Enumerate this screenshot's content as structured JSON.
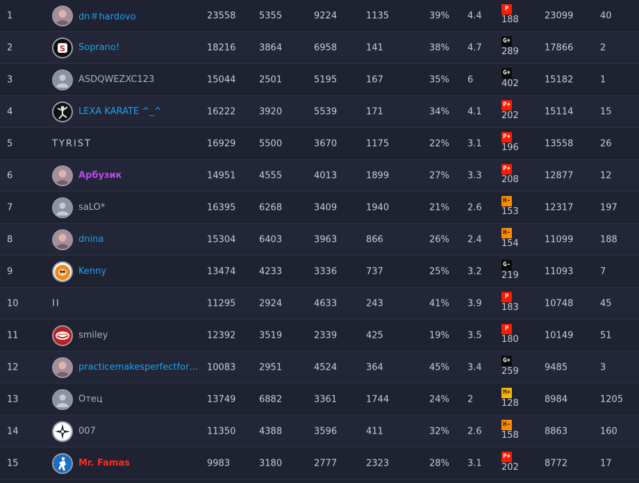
{
  "colors": {
    "P": {
      "bg": "#ff1a00",
      "fg": "#ffffff"
    },
    "P+": {
      "bg": "#ff1a00",
      "fg": "#ffffff"
    },
    "G+": {
      "bg": "#0b0b0b",
      "fg": "#ffffff"
    },
    "G-": {
      "bg": "#0b0b0b",
      "fg": "#ffffff"
    },
    "H-": {
      "bg": "#ff8a00",
      "fg": "#3a1a00"
    },
    "M+": {
      "bg": "#f0b800",
      "fg": "#3a2a00"
    }
  },
  "rows": [
    {
      "rank": "1",
      "name": "dn＃hardovo",
      "name_color": "blue",
      "avatar": "photo-avatar",
      "v1": "23558",
      "v2": "5355",
      "v3": "9224",
      "v4": "1135",
      "pct": "39%",
      "rating": "4.4",
      "badge": "P",
      "badge_num": "188",
      "v5": "23099",
      "last": "40"
    },
    {
      "rank": "2",
      "name": "Soprano!",
      "name_color": "blue",
      "avatar": "s-logo-avatar",
      "v1": "18216",
      "v2": "3864",
      "v3": "6958",
      "v4": "141",
      "pct": "38%",
      "rating": "4.7",
      "badge": "G+",
      "badge_num": "289",
      "v5": "17866",
      "last": "2"
    },
    {
      "rank": "3",
      "name": "ASDQWEZXC123",
      "name_color": "gray",
      "avatar": "default-avatar",
      "v1": "15044",
      "v2": "2501",
      "v3": "5195",
      "v4": "167",
      "pct": "35%",
      "rating": "6",
      "badge": "G+",
      "badge_num": "402",
      "v5": "15182",
      "last": "1"
    },
    {
      "rank": "4",
      "name": "LEXA KARATE ^_^",
      "name_color": "blue",
      "avatar": "karate-avatar",
      "v1": "16222",
      "v2": "3920",
      "v3": "5539",
      "v4": "171",
      "pct": "34%",
      "rating": "4.1",
      "badge": "P+",
      "badge_num": "202",
      "v5": "15114",
      "last": "15"
    },
    {
      "rank": "5",
      "name": "TYRIST",
      "name_color": "spaced",
      "avatar": "",
      "v1": "16929",
      "v2": "5500",
      "v3": "3670",
      "v4": "1175",
      "pct": "22%",
      "rating": "3.1",
      "badge": "P+",
      "badge_num": "196",
      "v5": "13558",
      "last": "26"
    },
    {
      "rank": "6",
      "name": "Арбузик",
      "name_color": "purple",
      "avatar": "photo-avatar",
      "v1": "14951",
      "v2": "4555",
      "v3": "4013",
      "v4": "1899",
      "pct": "27%",
      "rating": "3.3",
      "badge": "P+",
      "badge_num": "208",
      "v5": "12877",
      "last": "12"
    },
    {
      "rank": "7",
      "name": "saLO*",
      "name_color": "gray",
      "avatar": "default-avatar",
      "v1": "16395",
      "v2": "6268",
      "v3": "3409",
      "v4": "1940",
      "pct": "21%",
      "rating": "2.6",
      "badge": "H-",
      "badge_num": "153",
      "v5": "12317",
      "last": "197"
    },
    {
      "rank": "8",
      "name": "dnina",
      "name_color": "blue",
      "avatar": "photo-avatar",
      "v1": "15304",
      "v2": "6403",
      "v3": "3963",
      "v4": "866",
      "pct": "26%",
      "rating": "2.4",
      "badge": "H-",
      "badge_num": "154",
      "v5": "11099",
      "last": "188"
    },
    {
      "rank": "9",
      "name": "Kenny",
      "name_color": "blue",
      "avatar": "kenny-avatar",
      "v1": "13474",
      "v2": "4233",
      "v3": "3336",
      "v4": "737",
      "pct": "25%",
      "rating": "3.2",
      "badge": "G-",
      "badge_num": "219",
      "v5": "11093",
      "last": "7"
    },
    {
      "rank": "10",
      "name": "II",
      "name_color": "spaced",
      "avatar": "",
      "v1": "11295",
      "v2": "2924",
      "v3": "4633",
      "v4": "243",
      "pct": "41%",
      "rating": "3.9",
      "badge": "P",
      "badge_num": "183",
      "v5": "10748",
      "last": "45"
    },
    {
      "rank": "11",
      "name": "smiley",
      "name_color": "gray",
      "avatar": "smiley-avatar",
      "v1": "12392",
      "v2": "3519",
      "v3": "2339",
      "v4": "425",
      "pct": "19%",
      "rating": "3.5",
      "badge": "P",
      "badge_num": "180",
      "v5": "10149",
      "last": "51"
    },
    {
      "rank": "12",
      "name": "practicemakesperfectfor…",
      "name_color": "blue",
      "avatar": "photo-avatar",
      "v1": "10083",
      "v2": "2951",
      "v3": "4524",
      "v4": "364",
      "pct": "45%",
      "rating": "3.4",
      "badge": "G+",
      "badge_num": "259",
      "v5": "9485",
      "last": "3"
    },
    {
      "rank": "13",
      "name": "Отец",
      "name_color": "gray",
      "avatar": "default-avatar",
      "v1": "13749",
      "v2": "6882",
      "v3": "3361",
      "v4": "1744",
      "pct": "24%",
      "rating": "2",
      "badge": "M+",
      "badge_num": "128",
      "v5": "8984",
      "last": "1205"
    },
    {
      "rank": "14",
      "name": "007",
      "name_color": "gray",
      "avatar": "compass-avatar",
      "v1": "11350",
      "v2": "4388",
      "v3": "3596",
      "v4": "411",
      "pct": "32%",
      "rating": "2.6",
      "badge": "H-",
      "badge_num": "158",
      "v5": "8863",
      "last": "160"
    },
    {
      "rank": "15",
      "name": "Mr. Famas",
      "name_color": "red",
      "avatar": "cs-logo-avatar",
      "v1": "9983",
      "v2": "3180",
      "v3": "2777",
      "v4": "2323",
      "pct": "28%",
      "rating": "3.1",
      "badge": "P+",
      "badge_num": "202",
      "v5": "8772",
      "last": "17"
    }
  ]
}
